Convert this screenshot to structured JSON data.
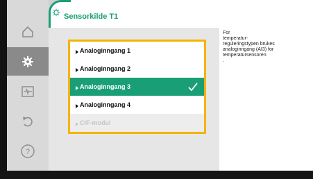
{
  "header": {
    "title": "Sensorkilde T1",
    "icon": "gear-icon"
  },
  "sidebar": {
    "items": [
      {
        "name": "home",
        "icon": "home-icon",
        "active": false
      },
      {
        "name": "settings",
        "icon": "gear-icon",
        "active": true
      },
      {
        "name": "diagnostics",
        "icon": "pulse-icon",
        "active": false
      },
      {
        "name": "back",
        "icon": "undo-icon",
        "active": false
      },
      {
        "name": "help",
        "icon": "help-icon",
        "active": false
      }
    ]
  },
  "options": [
    {
      "label": "Analoginngang 1",
      "state": "normal"
    },
    {
      "label": "Analoginngang 2",
      "state": "normal"
    },
    {
      "label": "Analoginngang 3",
      "state": "selected",
      "check": "check-icon"
    },
    {
      "label": "Analoginngang 4",
      "state": "normal"
    },
    {
      "label": "CIF-modul",
      "state": "disabled"
    }
  ],
  "info": {
    "text": "For\ntemperatur-\nreguleringstypen brukes\nanaloginngang (AI3) for\ntemperatursensoren\n."
  },
  "colors": {
    "accent": "#1a9e76",
    "focus": "#f4b400",
    "sidebar": "#d9d9d9",
    "sidebar_active": "#8a8a8a",
    "content_bg": "#e6e6e6"
  }
}
